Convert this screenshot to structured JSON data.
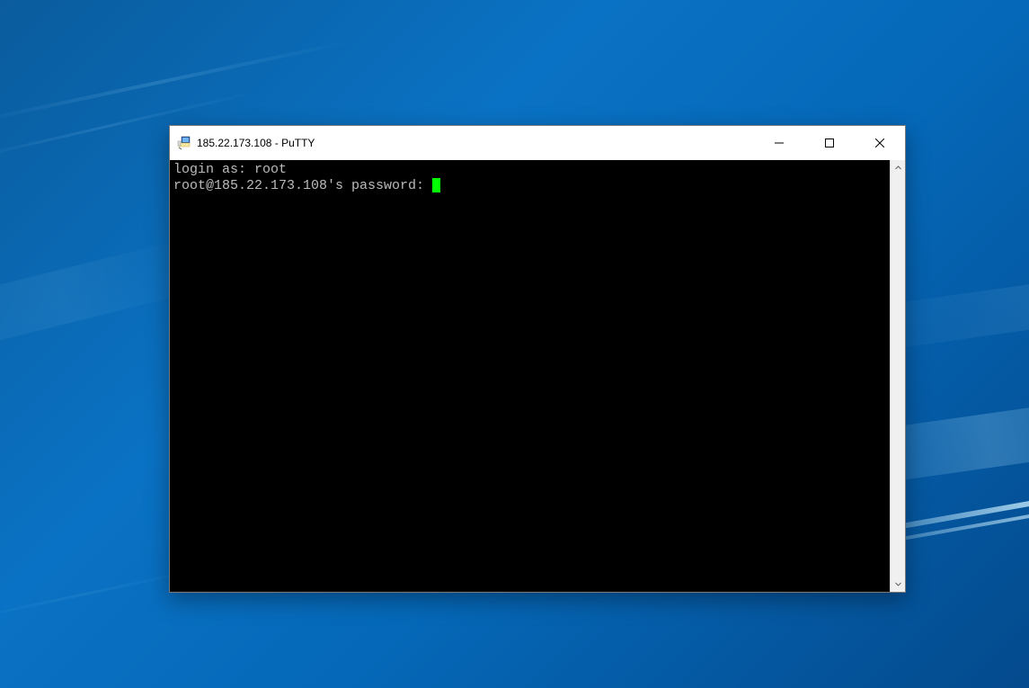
{
  "window": {
    "title": "185.22.173.108 - PuTTY"
  },
  "terminal": {
    "lines": [
      {
        "prompt": "login as: ",
        "input": "root"
      },
      {
        "prompt": "root@185.22.173.108's password: ",
        "input": ""
      }
    ]
  }
}
